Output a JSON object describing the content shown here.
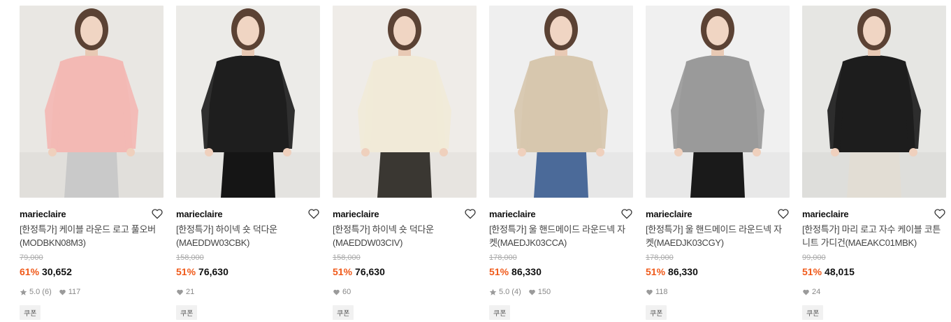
{
  "products": [
    {
      "brand": "marieclaire",
      "title": "[한정특가] 케이블 라운드 로고 풀오버 (MODBKN08M3)",
      "original_price": "79,000",
      "discount_rate": "61%",
      "sale_price": "30,652",
      "rating": "5.0",
      "review_count": "(6)",
      "likes": "117",
      "coupon": "쿠폰",
      "bg": "#e9e7e3",
      "garment": "#f3b9b4",
      "bottom": "#c9c9c9"
    },
    {
      "brand": "marieclaire",
      "title": "[한정특가] 하이넥 숏 덕다운 (MAEDDW03CBK)",
      "original_price": "158,000",
      "discount_rate": "51%",
      "sale_price": "76,630",
      "likes": "21",
      "coupon": "쿠폰",
      "bg": "#ecebe8",
      "garment": "#1e1e1e",
      "bottom": "#151515"
    },
    {
      "brand": "marieclaire",
      "title": "[한정특가] 하이넥 숏 덕다운 (MAEDDW03CIV)",
      "original_price": "158,000",
      "discount_rate": "51%",
      "sale_price": "76,630",
      "likes": "60",
      "coupon": "쿠폰",
      "bg": "#efece8",
      "garment": "#f1ead8",
      "bottom": "#3a3732"
    },
    {
      "brand": "marieclaire",
      "title": "[한정특가] 울 핸드메이드 라운드넥 자켓(MAEDJK03CCA)",
      "original_price": "178,000",
      "discount_rate": "51%",
      "sale_price": "86,330",
      "rating": "5.0",
      "review_count": "(4)",
      "likes": "150",
      "coupon": "쿠폰",
      "bg": "#efefef",
      "garment": "#d7c7ae",
      "bottom": "#4b6a99"
    },
    {
      "brand": "marieclaire",
      "title": "[한정특가] 울 핸드메이드 라운드넥 자켓(MAEDJK03CGY)",
      "original_price": "178,000",
      "discount_rate": "51%",
      "sale_price": "86,330",
      "likes": "118",
      "coupon": "쿠폰",
      "bg": "#f0f0f0",
      "garment": "#9a9a9a",
      "bottom": "#1a1a1a"
    },
    {
      "brand": "marieclaire",
      "title": "[한정특가] 마리 로고 자수 케이블 코튼 니트 가디건(MAEAKC01MBK)",
      "original_price": "99,000",
      "discount_rate": "51%",
      "sale_price": "48,015",
      "likes": "24",
      "coupon": "쿠폰",
      "bg": "#e6e6e3",
      "garment": "#1d1d1d",
      "bottom": "#e2ddd4"
    }
  ]
}
